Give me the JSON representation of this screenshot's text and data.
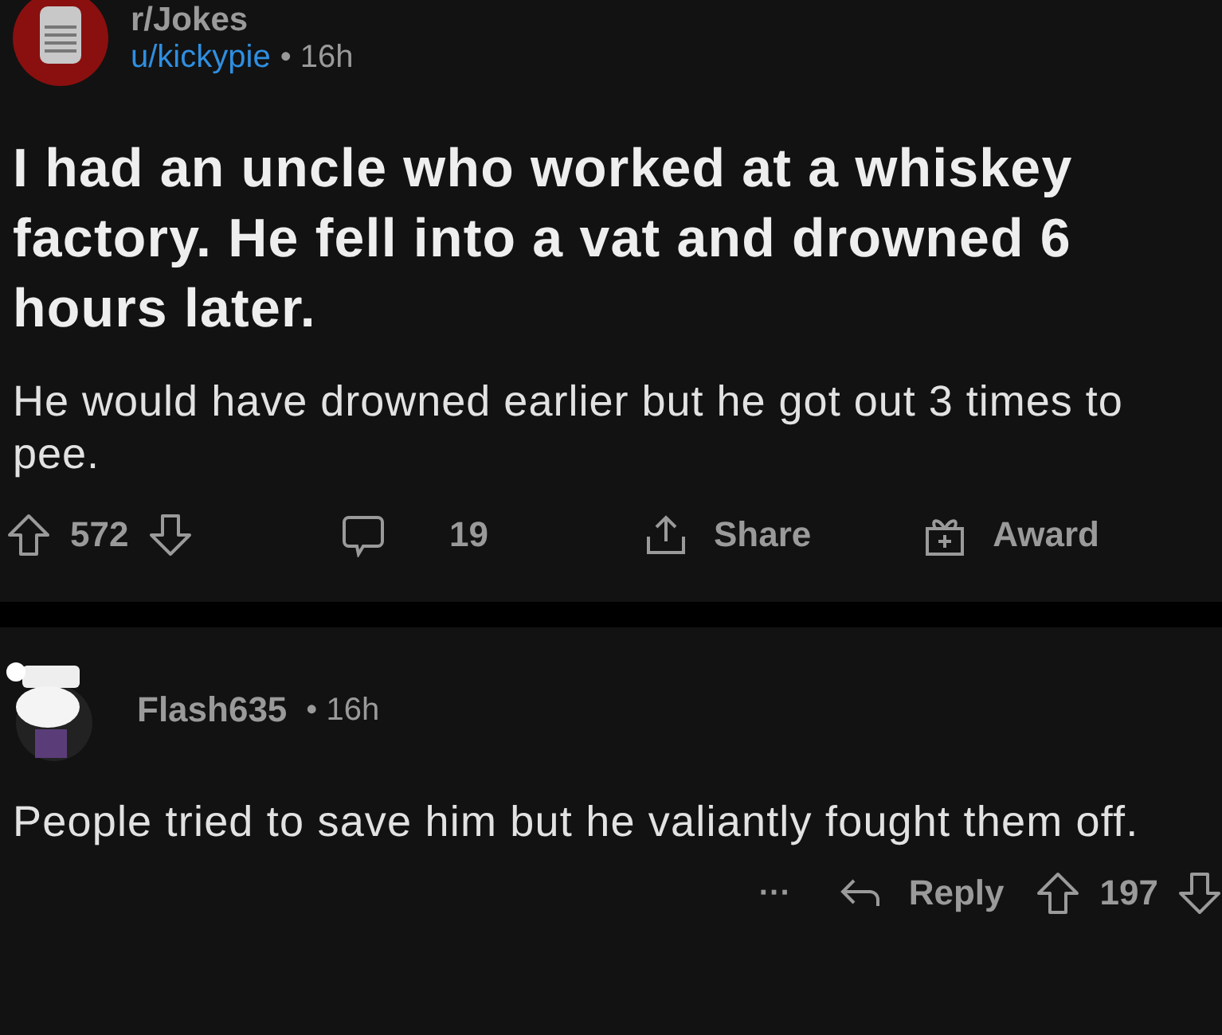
{
  "post": {
    "subreddit": "r/Jokes",
    "author": "u/kickypie",
    "age": "• 16h",
    "title": "I had an uncle who worked at a whiskey factory. He fell into a vat and drowned 6 hours later.",
    "body": "He would have drowned earlier but he got out 3 times to pee.",
    "actions": [
      {
        "kind": "votes",
        "label": "572"
      },
      {
        "kind": "comments",
        "label": "19"
      },
      {
        "kind": "share",
        "label": "Share"
      },
      {
        "kind": "award",
        "label": "Award"
      }
    ]
  },
  "comment": {
    "author": "Flash635",
    "age": "• 16h",
    "body": "People tried to save him but he valiantly fought them off.",
    "actions": [
      {
        "kind": "more",
        "label": "···"
      },
      {
        "kind": "reply",
        "label": "Reply"
      },
      {
        "kind": "votes",
        "label": "197"
      }
    ]
  }
}
